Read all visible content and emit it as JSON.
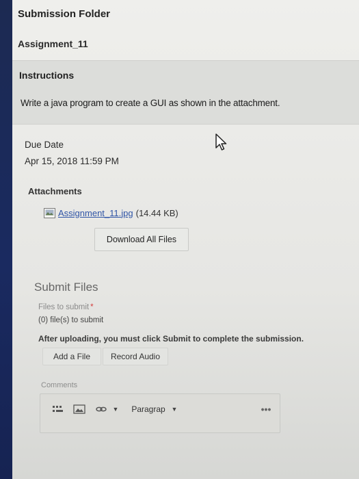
{
  "folder": {
    "title": "Submission Folder",
    "assignment_name": "Assignment_11"
  },
  "instructions": {
    "heading": "Instructions",
    "text": "Write a java program to create a GUI as shown in the attachment."
  },
  "due": {
    "label": "Due Date",
    "value": "Apr 15, 2018 11:59 PM"
  },
  "attachments": {
    "label": "Attachments",
    "file_name": "Assignment_11.jpg",
    "file_size": "(14.44 KB)",
    "download_all_label": "Download All Files"
  },
  "submit": {
    "heading": "Submit Files",
    "files_label": "Files to submit",
    "required_mark": "*",
    "files_count": "(0) file(s) to submit",
    "note": "After uploading, you must click Submit to complete the submission.",
    "add_file_label": "Add a File",
    "record_audio_label": "Record Audio"
  },
  "comments": {
    "label": "Comments",
    "paragraph_select": "Paragrap",
    "more_label": "•••"
  },
  "icons": {
    "file": "image-file-icon",
    "cursor": "mouse-pointer-icon",
    "toolbar_1": "insert-stuff-icon",
    "toolbar_2": "insert-image-icon",
    "toolbar_3": "insert-link-icon"
  }
}
